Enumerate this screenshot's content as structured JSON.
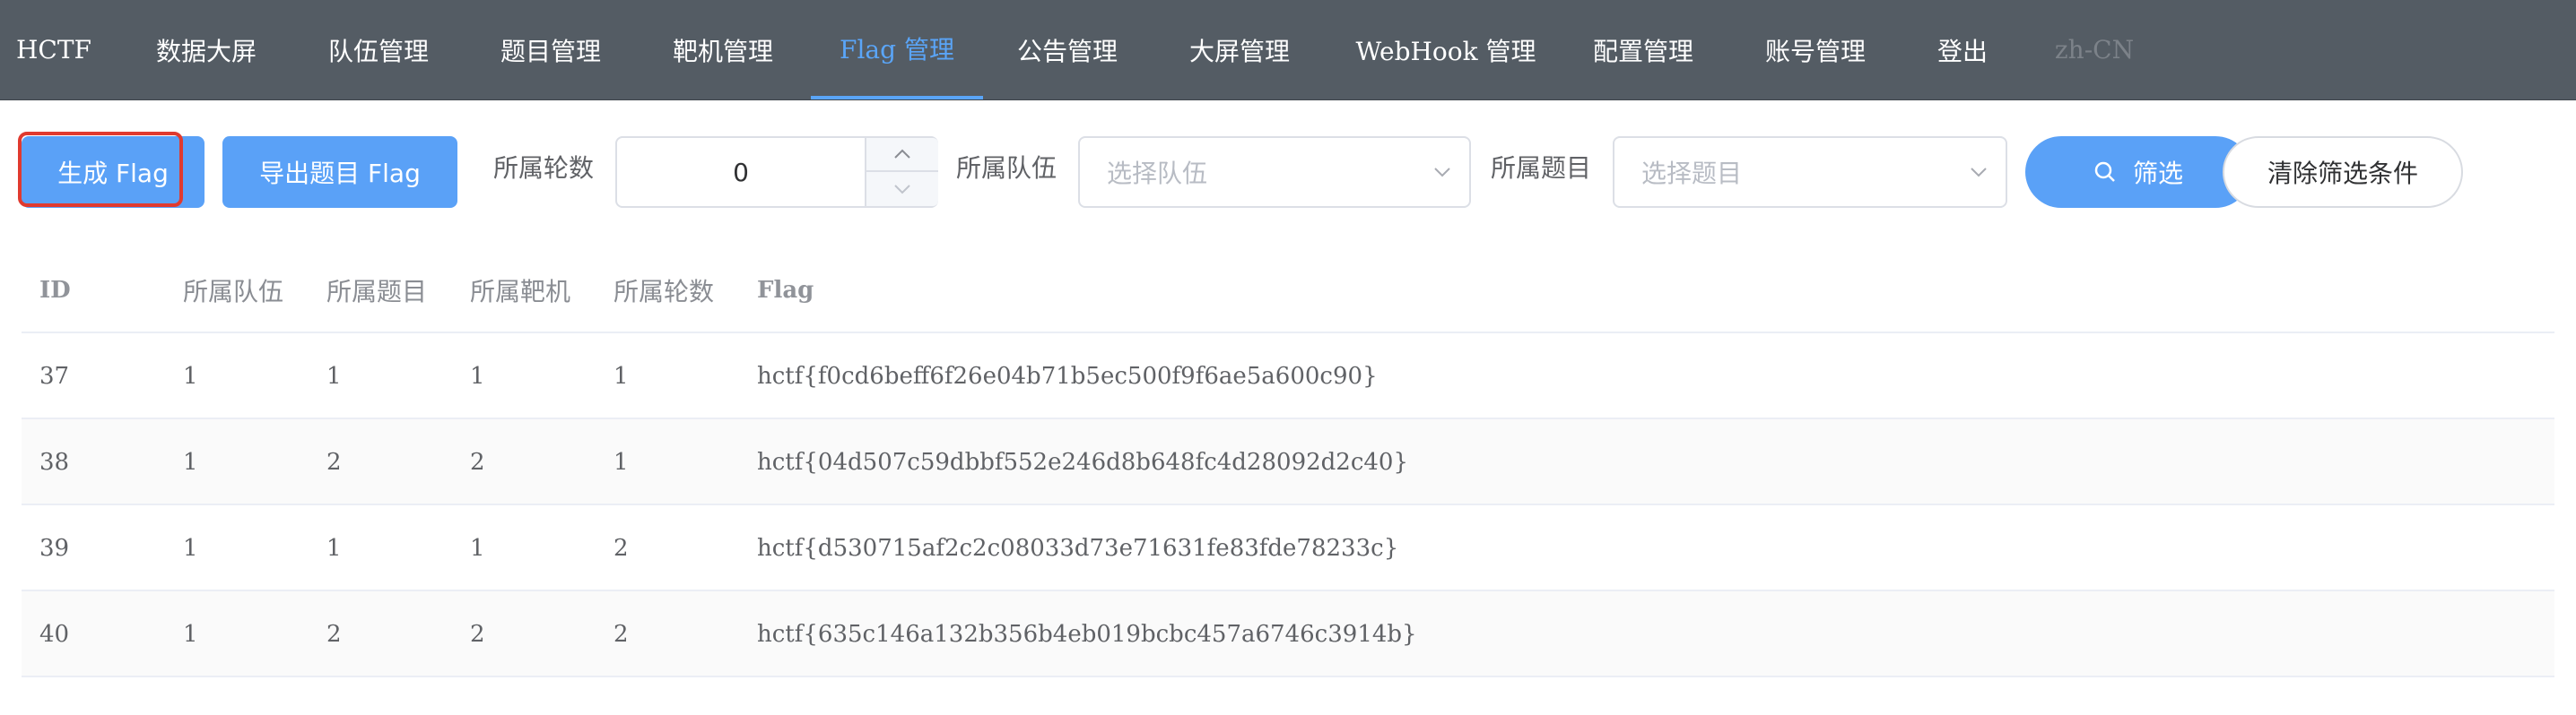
{
  "nav": {
    "items": [
      {
        "label": "HCTF"
      },
      {
        "label": "数据大屏"
      },
      {
        "label": "队伍管理"
      },
      {
        "label": "题目管理"
      },
      {
        "label": "靶机管理"
      },
      {
        "label": "Flag 管理"
      },
      {
        "label": "公告管理"
      },
      {
        "label": "大屏管理"
      },
      {
        "label": "WebHook 管理"
      },
      {
        "label": "配置管理"
      },
      {
        "label": "账号管理"
      },
      {
        "label": "登出"
      },
      {
        "label": "zh-CN"
      }
    ],
    "active_index": 5,
    "active_color": "#5aa5f8",
    "background": "#545c64"
  },
  "toolbar": {
    "generate_label": "生成 Flag",
    "export_label": "导出题目 Flag",
    "round_label": "所属轮数",
    "round_value": "0",
    "team_label": "所属队伍",
    "team_placeholder": "选择队伍",
    "challenge_label": "所属题目",
    "challenge_placeholder": "选择题目",
    "filter_label": "筛选",
    "clear_label": "清除筛选条件",
    "primary_color": "#5aa1f7",
    "highlight_color": "#e03a2f"
  },
  "table": {
    "columns": [
      "ID",
      "所属队伍",
      "所属题目",
      "所属靶机",
      "所属轮数",
      "Flag"
    ],
    "rows": [
      [
        "37",
        "1",
        "1",
        "1",
        "1",
        "hctf{f0cd6beff6f26e04b71b5ec500f9f6ae5a600c90}"
      ],
      [
        "38",
        "1",
        "2",
        "2",
        "1",
        "hctf{04d507c59dbbf552e246d8b648fc4d28092d2c40}"
      ],
      [
        "39",
        "1",
        "1",
        "1",
        "2",
        "hctf{d530715af2c2c08033d73e71631fe83fde78233c}"
      ],
      [
        "40",
        "1",
        "2",
        "2",
        "2",
        "hctf{635c146a132b356b4eb019bcbc457a6746c3914b}"
      ]
    ]
  }
}
